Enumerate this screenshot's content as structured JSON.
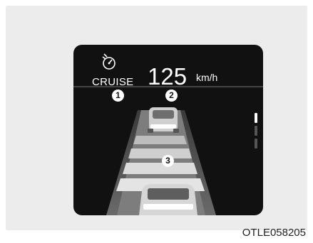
{
  "cluster": {
    "cruise_icon": "speedometer-cruise-icon",
    "cruise_label": "CRUISE",
    "set_speed": "125",
    "speed_unit": "km/h",
    "callouts": {
      "cruise": "1",
      "vehicle_ahead": "2",
      "distance": "3"
    }
  },
  "image_code": "OTLE058205",
  "colors": {
    "display_bg": "#111111",
    "lane_light": "#d8d8d8",
    "lane_dark": "#8a8a8a",
    "text": "#ffffff"
  }
}
